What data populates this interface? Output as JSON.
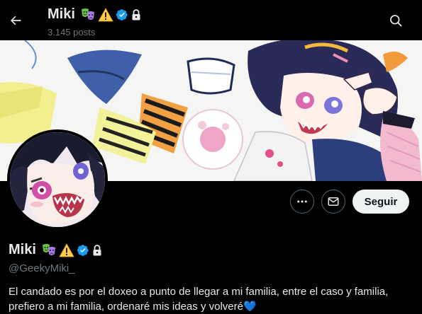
{
  "header": {
    "name": "Miki",
    "posts_count": "3.145 posts",
    "back_icon": "arrow-left-icon",
    "search_icon": "search-icon"
  },
  "profile": {
    "name": "Miki",
    "handle": "@GeekyMiki_",
    "bio": "El candado es por el doxeo a punto de llegar a mi familia, entre el caso y familia, prefiero a mi familia, ordenaré mis ideas y volveré💙",
    "name_badges": [
      "theater-masks-emoji",
      "warning-emoji",
      "verified-badge-icon",
      "lock-icon"
    ]
  },
  "actions": {
    "more_icon": "more-horizontal-icon",
    "message_icon": "envelope-icon",
    "follow_label": "Seguir"
  },
  "colors": {
    "background": "#000000",
    "primary_text": "#e7e9ea",
    "secondary_text": "#71767b",
    "verified_blue": "#1d9bf0",
    "follow_button_bg": "#eff3f4",
    "follow_button_text": "#0f1419"
  }
}
